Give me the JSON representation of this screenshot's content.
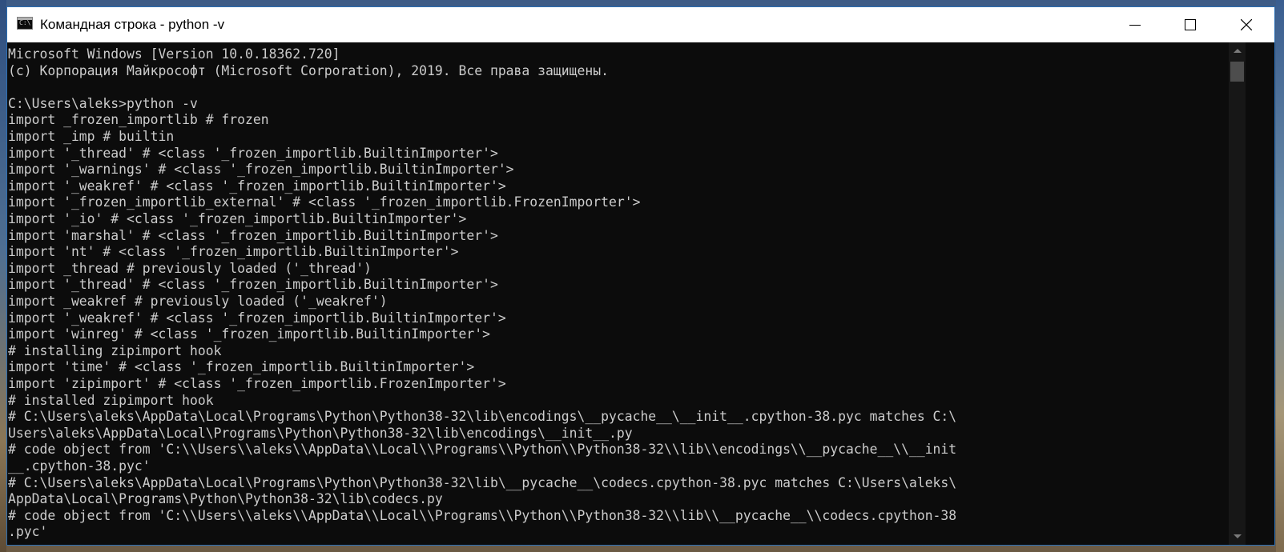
{
  "window": {
    "title": "Командная строка - python  -v",
    "icon": "cmd-icon",
    "icon_text": "C:\\"
  },
  "console": {
    "lines": [
      "Microsoft Windows [Version 10.0.18362.720]",
      "(c) Корпорация Майкрософт (Microsoft Corporation), 2019. Все права защищены.",
      "",
      "C:\\Users\\aleks>python -v",
      "import _frozen_importlib # frozen",
      "import _imp # builtin",
      "import '_thread' # <class '_frozen_importlib.BuiltinImporter'>",
      "import '_warnings' # <class '_frozen_importlib.BuiltinImporter'>",
      "import '_weakref' # <class '_frozen_importlib.BuiltinImporter'>",
      "import '_frozen_importlib_external' # <class '_frozen_importlib.FrozenImporter'>",
      "import '_io' # <class '_frozen_importlib.BuiltinImporter'>",
      "import 'marshal' # <class '_frozen_importlib.BuiltinImporter'>",
      "import 'nt' # <class '_frozen_importlib.BuiltinImporter'>",
      "import _thread # previously loaded ('_thread')",
      "import '_thread' # <class '_frozen_importlib.BuiltinImporter'>",
      "import _weakref # previously loaded ('_weakref')",
      "import '_weakref' # <class '_frozen_importlib.BuiltinImporter'>",
      "import 'winreg' # <class '_frozen_importlib.BuiltinImporter'>",
      "# installing zipimport hook",
      "import 'time' # <class '_frozen_importlib.BuiltinImporter'>",
      "import 'zipimport' # <class '_frozen_importlib.FrozenImporter'>",
      "# installed zipimport hook",
      "# C:\\Users\\aleks\\AppData\\Local\\Programs\\Python\\Python38-32\\lib\\encodings\\__pycache__\\__init__.cpython-38.pyc matches C:\\",
      "Users\\aleks\\AppData\\Local\\Programs\\Python\\Python38-32\\lib\\encodings\\__init__.py",
      "# code object from 'C:\\\\Users\\\\aleks\\\\AppData\\\\Local\\\\Programs\\\\Python\\\\Python38-32\\\\lib\\\\encodings\\\\__pycache__\\\\__init",
      "__.cpython-38.pyc'",
      "# C:\\Users\\aleks\\AppData\\Local\\Programs\\Python\\Python38-32\\lib\\__pycache__\\codecs.cpython-38.pyc matches C:\\Users\\aleks\\",
      "AppData\\Local\\Programs\\Python\\Python38-32\\lib\\codecs.py",
      "# code object from 'C:\\\\Users\\\\aleks\\\\AppData\\\\Local\\\\Programs\\\\Python\\\\Python38-32\\\\lib\\\\__pycache__\\\\codecs.cpython-38",
      ".pyc'"
    ]
  },
  "colors": {
    "console_bg": "#0c0c0c",
    "console_text": "#cccccc",
    "titlebar_bg": "#ffffff",
    "window_border": "#2b6fb5"
  }
}
